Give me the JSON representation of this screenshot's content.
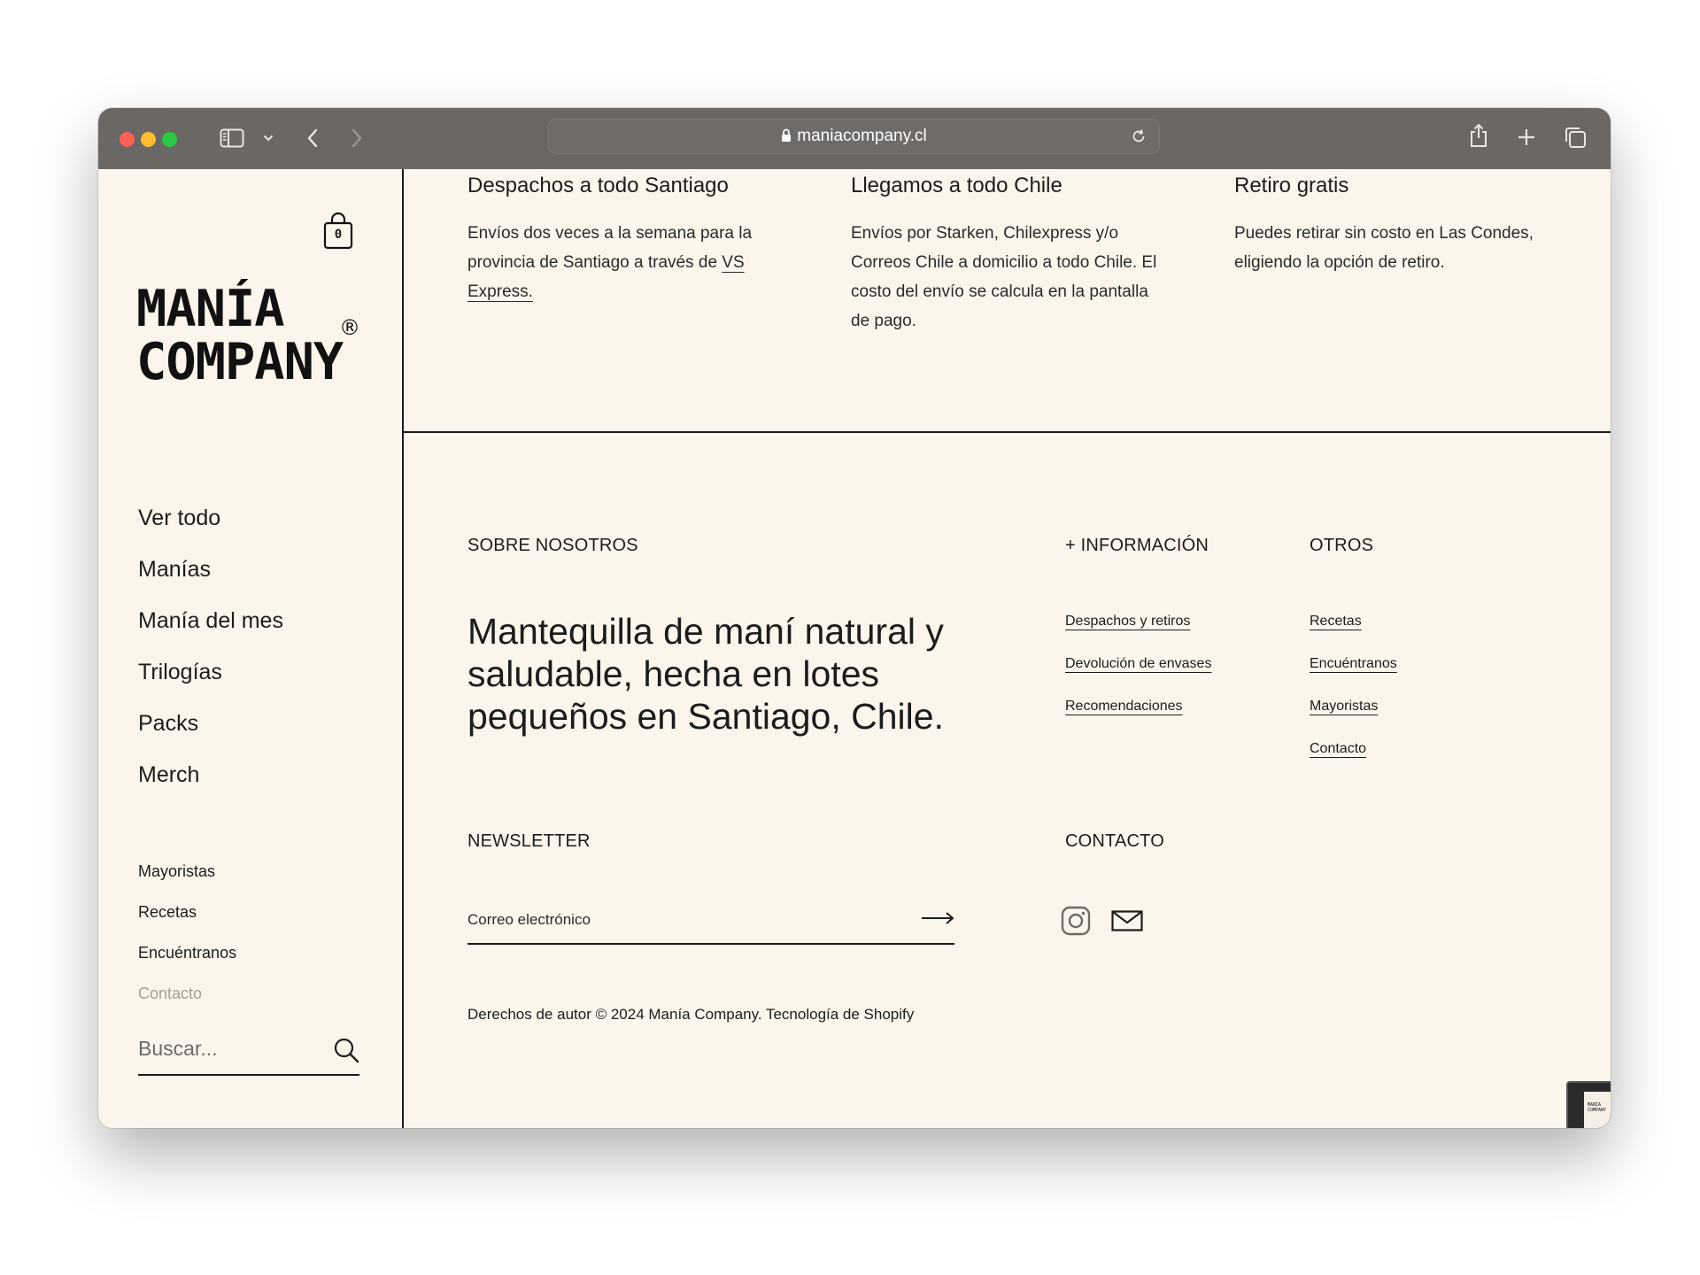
{
  "browser": {
    "url": "maniacompany.cl",
    "colors": {
      "close": "#fe5f57",
      "minimize": "#febc2e",
      "zoom": "#28c840"
    }
  },
  "store": {
    "cart_count": "0",
    "logo_line1": "MANÍA",
    "logo_line2": "COMPANY",
    "logo_mark": "®"
  },
  "nav": {
    "main": [
      "Ver todo",
      "Manías",
      "Manía del mes",
      "Trilogías",
      "Packs",
      "Merch"
    ],
    "secondary": [
      "Mayoristas",
      "Recetas",
      "Encuéntranos",
      "Contacto"
    ],
    "search_placeholder": "Buscar..."
  },
  "shipping": [
    {
      "title": "Despachos a todo Santiago",
      "body": "Envíos dos veces a la semana para la provincia de Santiago a través de ",
      "link": "VS Express."
    },
    {
      "title": "Llegamos a todo Chile",
      "body": "Envíos por Starken, Chilexpress y/o Correos Chile a domicilio a todo Chile. El costo del envío se calcula en la pantalla de pago."
    },
    {
      "title": "Retiro gratis",
      "body": "Puedes retirar sin costo en Las Condes, eligiendo la opción de retiro."
    }
  ],
  "footer": {
    "about_heading": "SOBRE NOSOTROS",
    "about_text": "Mantequilla de maní natural y saludable, hecha en lotes pequeños en Santiago, Chile.",
    "info_heading": "+ INFORMACIÓN",
    "info_links": [
      "Despachos y retiros",
      "Devolución de envases",
      "Recomendaciones"
    ],
    "other_heading": "OTROS",
    "other_links": [
      "Recetas",
      "Encuéntranos",
      "Mayoristas",
      "Contacto"
    ],
    "newsletter_heading": "NEWSLETTER",
    "newsletter_placeholder": "Correo electrónico",
    "contact_heading": "CONTACTO",
    "copyright": "Derechos de autor © 2024 Manía Company. Tecnología de Shopify"
  },
  "thumbnail_text": "MANÍA COMPANY"
}
